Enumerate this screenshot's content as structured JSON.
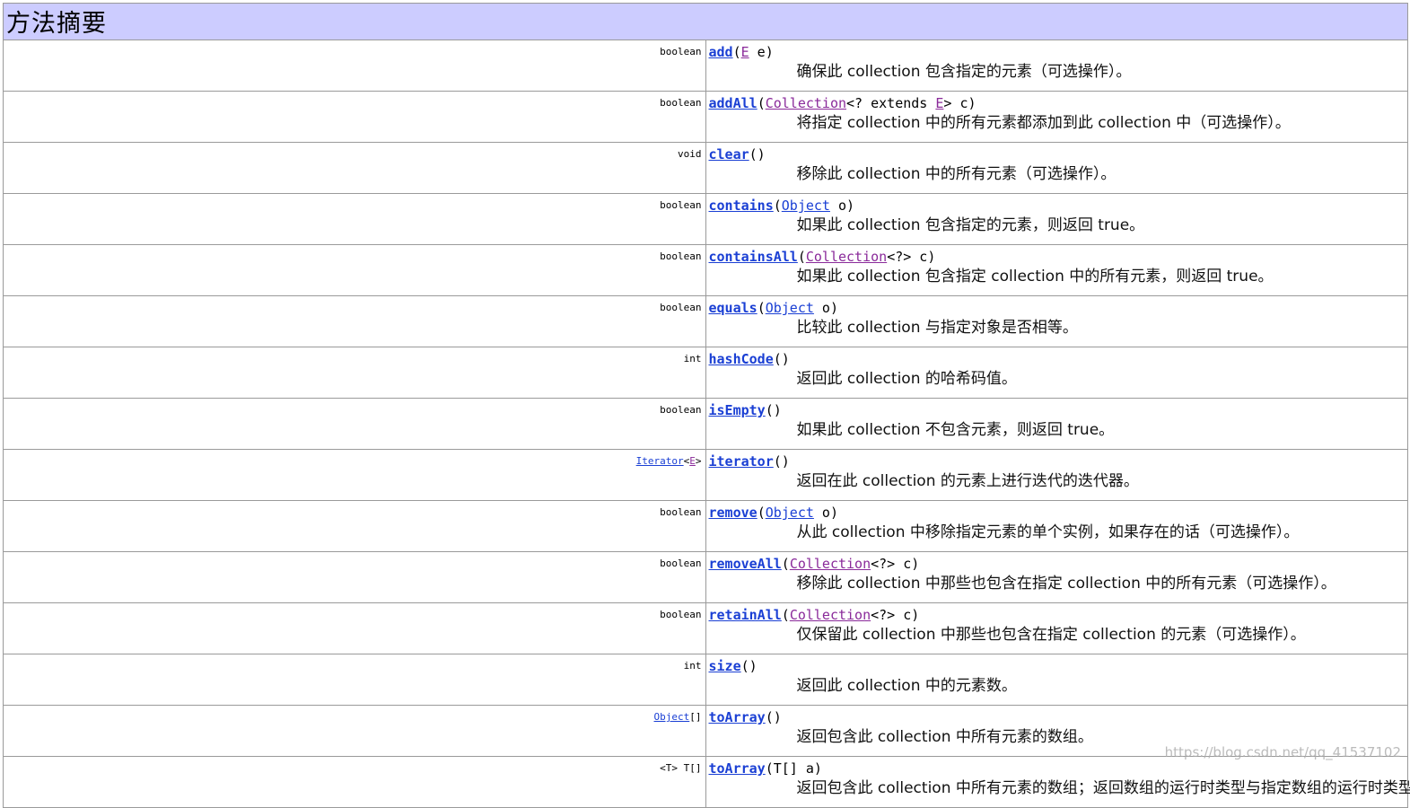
{
  "header": {
    "title": "方法摘要"
  },
  "methods": [
    {
      "type": "boolean",
      "name": "add",
      "open": "(",
      "param_type": "E",
      "close": " e)",
      "description": "确保此 collection 包含指定的元素（可选操作）。"
    },
    {
      "type": "boolean",
      "name": "addAll",
      "open": "(",
      "param_type": "Collection",
      "mid": "<? extends ",
      "param_type2": "E",
      "close": "> c)",
      "description": "将指定 collection 中的所有元素都添加到此 collection 中（可选操作）。"
    },
    {
      "type": "void",
      "name": "clear",
      "open": "()",
      "description": "移除此 collection 中的所有元素（可选操作）。"
    },
    {
      "type": "boolean",
      "name": "contains",
      "open": "(",
      "param_type": "Object",
      "close": " o)",
      "description": "如果此 collection 包含指定的元素，则返回 true。"
    },
    {
      "type": "boolean",
      "name": "containsAll",
      "open": "(",
      "param_type": "Collection",
      "close": "<?> c)",
      "description": "如果此 collection 包含指定 collection 中的所有元素，则返回 true。"
    },
    {
      "type": "boolean",
      "name": "equals",
      "open": "(",
      "param_type": "Object",
      "close": " o)",
      "description": "比较此 collection 与指定对象是否相等。"
    },
    {
      "type": "int",
      "name": "hashCode",
      "open": "()",
      "description": "返回此 collection 的哈希码值。"
    },
    {
      "type": "boolean",
      "name": "isEmpty",
      "open": "()",
      "description": "如果此 collection 不包含元素，则返回 true。"
    },
    {
      "type_link": "Iterator",
      "type_open": "<",
      "type_param": "E",
      "type_close": ">",
      "name": "iterator",
      "open": "()",
      "description": "返回在此 collection 的元素上进行迭代的迭代器。"
    },
    {
      "type": "boolean",
      "name": "remove",
      "open": "(",
      "param_type": "Object",
      "close": " o)",
      "description": "从此 collection 中移除指定元素的单个实例，如果存在的话（可选操作）。"
    },
    {
      "type": "boolean",
      "name": "removeAll",
      "open": "(",
      "param_type": "Collection",
      "close": "<?> c)",
      "description": "移除此 collection 中那些也包含在指定 collection 中的所有元素（可选操作）。"
    },
    {
      "type": "boolean",
      "name": "retainAll",
      "open": "(",
      "param_type": "Collection",
      "close": "<?> c)",
      "description": "仅保留此 collection 中那些也包含在指定 collection 的元素（可选操作）。"
    },
    {
      "type": "int",
      "name": "size",
      "open": "()",
      "description": "返回此 collection 中的元素数。"
    },
    {
      "type_link": "Object",
      "type_close": "[]",
      "name": "toArray",
      "open": "()",
      "description": "返回包含此 collection 中所有元素的数组。"
    },
    {
      "type": "<T> T[]",
      "name": "toArray",
      "open": "(T[] a)",
      "description": "返回包含此 collection 中所有元素的数组；返回数组的运行时类型与指定数组的运行时类型相同。"
    }
  ],
  "watermark": "https://blog.csdn.net/qq_41537102"
}
